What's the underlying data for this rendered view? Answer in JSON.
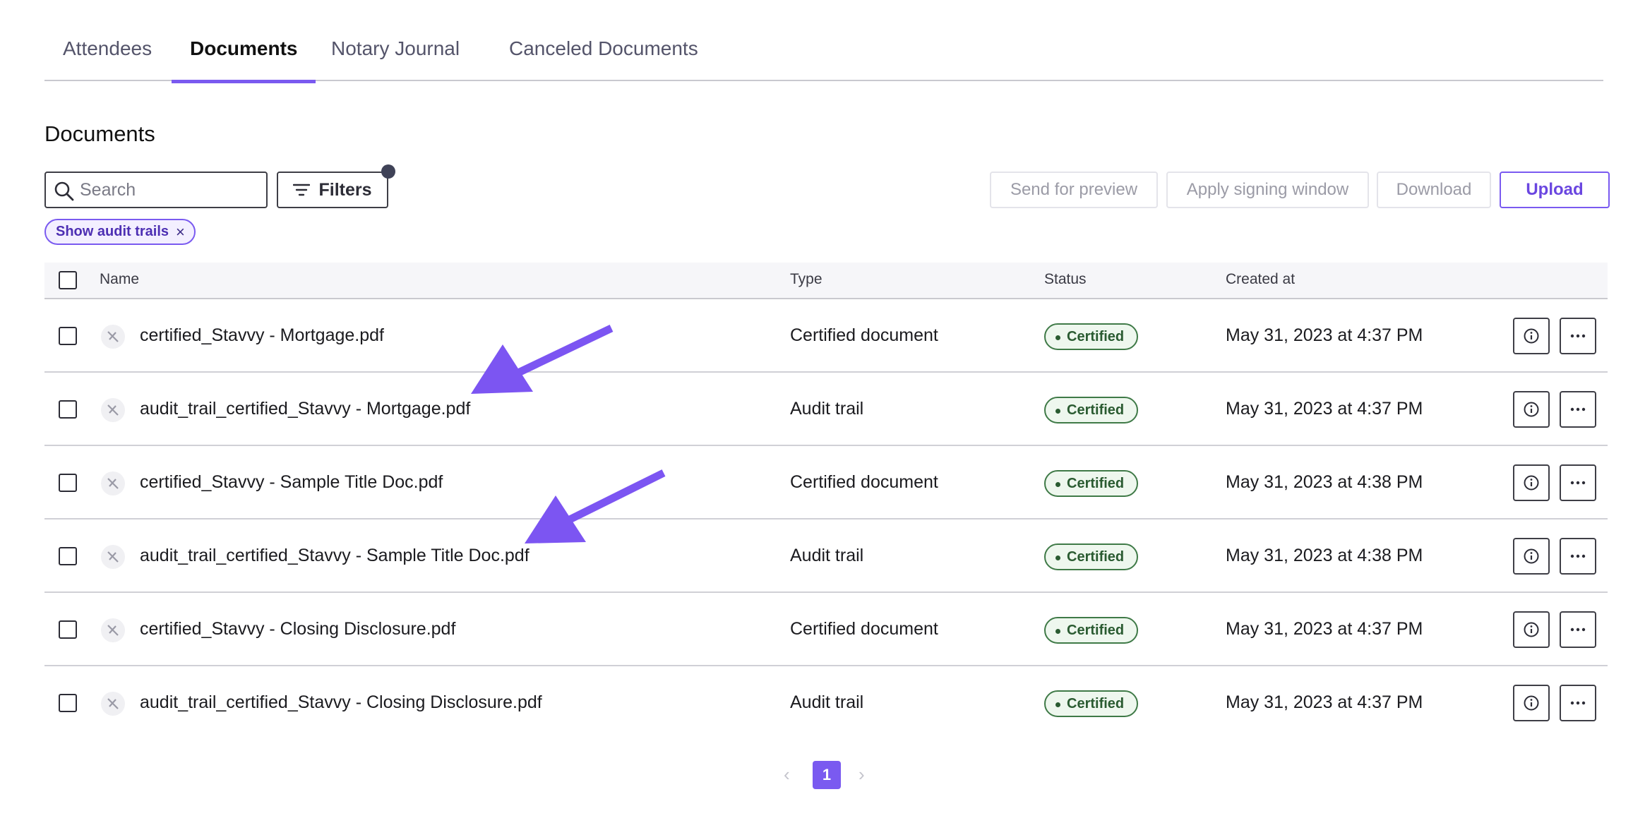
{
  "tabs": [
    {
      "label": "Attendees",
      "active": false
    },
    {
      "label": "Documents",
      "active": true
    },
    {
      "label": "Notary Journal",
      "active": false
    },
    {
      "label": "Canceled Documents",
      "active": false
    }
  ],
  "section_title": "Documents",
  "search": {
    "placeholder": "Search",
    "value": ""
  },
  "toolbar": {
    "filters_label": "Filters",
    "send_preview_label": "Send for preview",
    "apply_window_label": "Apply signing window",
    "download_label": "Download",
    "upload_label": "Upload"
  },
  "filter_chip": {
    "label": "Show audit trails",
    "close": "×"
  },
  "table": {
    "headers": {
      "name": "Name",
      "type": "Type",
      "status": "Status",
      "created": "Created at"
    },
    "rows": [
      {
        "name": "certified_Stavvy - Mortgage.pdf",
        "type": "Certified document",
        "status": "Certified",
        "created": "May 31, 2023 at 4:37 PM"
      },
      {
        "name": "audit_trail_certified_Stavvy - Mortgage.pdf",
        "type": "Audit trail",
        "status": "Certified",
        "created": "May 31, 2023 at 4:37 PM"
      },
      {
        "name": "certified_Stavvy - Sample Title Doc.pdf",
        "type": "Certified document",
        "status": "Certified",
        "created": "May 31, 2023 at 4:38 PM"
      },
      {
        "name": "audit_trail_certified_Stavvy - Sample Title Doc.pdf",
        "type": "Audit trail",
        "status": "Certified",
        "created": "May 31, 2023 at 4:38 PM"
      },
      {
        "name": "certified_Stavvy - Closing Disclosure.pdf",
        "type": "Certified document",
        "status": "Certified",
        "created": "May 31, 2023 at 4:37 PM"
      },
      {
        "name": "audit_trail_certified_Stavvy - Closing Disclosure.pdf",
        "type": "Audit trail",
        "status": "Certified",
        "created": "May 31, 2023 at 4:37 PM"
      }
    ]
  },
  "pagination": {
    "prev": "‹",
    "current": "1",
    "next": "›"
  },
  "colors": {
    "accent": "#7a5af0",
    "status_green": "#2a5b31",
    "annotation_arrow": "#7c55f2"
  },
  "icons": [
    "search-icon",
    "filter-icon",
    "document-icon",
    "info-icon",
    "more-icon"
  ]
}
